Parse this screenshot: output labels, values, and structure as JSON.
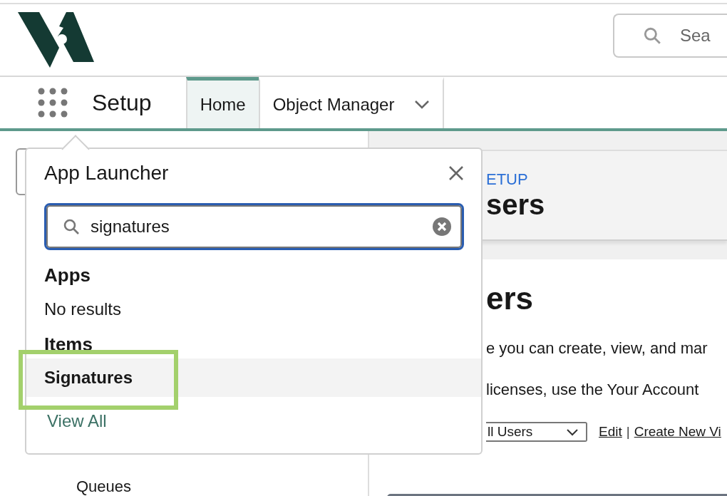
{
  "header": {
    "search": {
      "placeholder": "Sea"
    }
  },
  "nav": {
    "app_title": "Setup",
    "tabs": [
      {
        "label": "Home",
        "selected": true,
        "has_menu": false
      },
      {
        "label": "Object Manager",
        "selected": false,
        "has_menu": true
      }
    ]
  },
  "sidebar": {
    "items": [
      {
        "label": "Queues"
      }
    ]
  },
  "page_header": {
    "breadcrumb": "ETUP",
    "title": "sers"
  },
  "content": {
    "heading": "ers",
    "lines": [
      "e you can create, view, and mar",
      "licenses, use the Your Account"
    ],
    "view_select": {
      "value": "ll Users"
    },
    "links": [
      "Edit",
      "Create New Vi"
    ],
    "separator": "|"
  },
  "app_launcher": {
    "title": "App Launcher",
    "search": {
      "value": "signatures"
    },
    "sections": [
      {
        "heading": "Apps",
        "kind": "empty",
        "text": "No results"
      },
      {
        "heading": "Items",
        "kind": "list",
        "items": [
          {
            "label": "Signatures",
            "selected": true,
            "highlighted": true
          }
        ]
      }
    ],
    "view_all": "View All"
  }
}
